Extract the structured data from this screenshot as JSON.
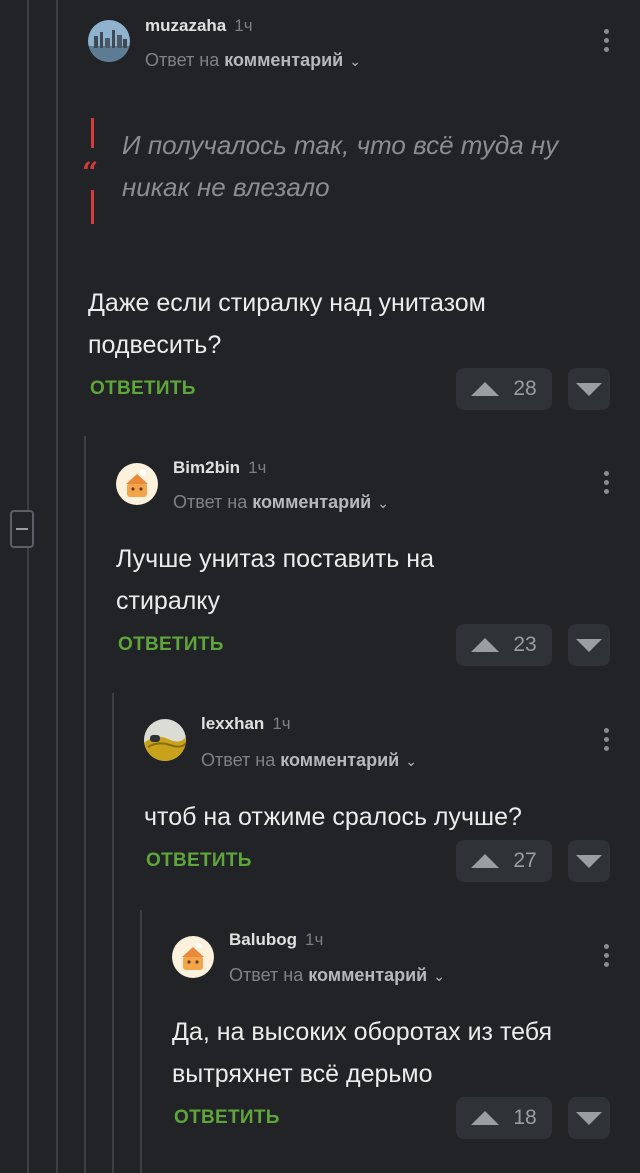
{
  "comments": [
    {
      "username": "muzazaha",
      "time": "1ч",
      "reply_prefix": "Ответ на",
      "reply_target": "комментарий",
      "quote": "И получалось так, что всё туда ну никак не влезало",
      "text": "Даже если стиралку над унитазом подвесить?",
      "reply_label": "ОТВЕТИТЬ",
      "votes": "28"
    },
    {
      "username": "Bim2bin",
      "time": "1ч",
      "reply_prefix": "Ответ на",
      "reply_target": "комментарий",
      "text": "Лучше унитаз поставить на стиралку",
      "reply_label": "ОТВЕТИТЬ",
      "votes": "23"
    },
    {
      "username": "lexxhan",
      "time": "1ч",
      "reply_prefix": "Ответ на",
      "reply_target": "комментарий",
      "text": "чтоб на отжиме сралось лучше?",
      "reply_label": "ОТВЕТИТЬ",
      "votes": "27"
    },
    {
      "username": "Balubog",
      "time": "1ч",
      "reply_prefix": "Ответ на",
      "reply_target": "комментарий",
      "text": "Да, на высоких оборотах из тебя вытряхнет всё дерьмо",
      "reply_label": "ОТВЕТИТЬ",
      "votes": "18"
    }
  ],
  "colors": {
    "background": "#212326",
    "reply_accent": "#5ea63a",
    "quote_accent": "#d33a3a"
  },
  "icons": [
    "collapse-thread-icon",
    "more-vertical-icon",
    "chevron-down-icon",
    "upvote-arrow-icon",
    "downvote-arrow-icon"
  ]
}
